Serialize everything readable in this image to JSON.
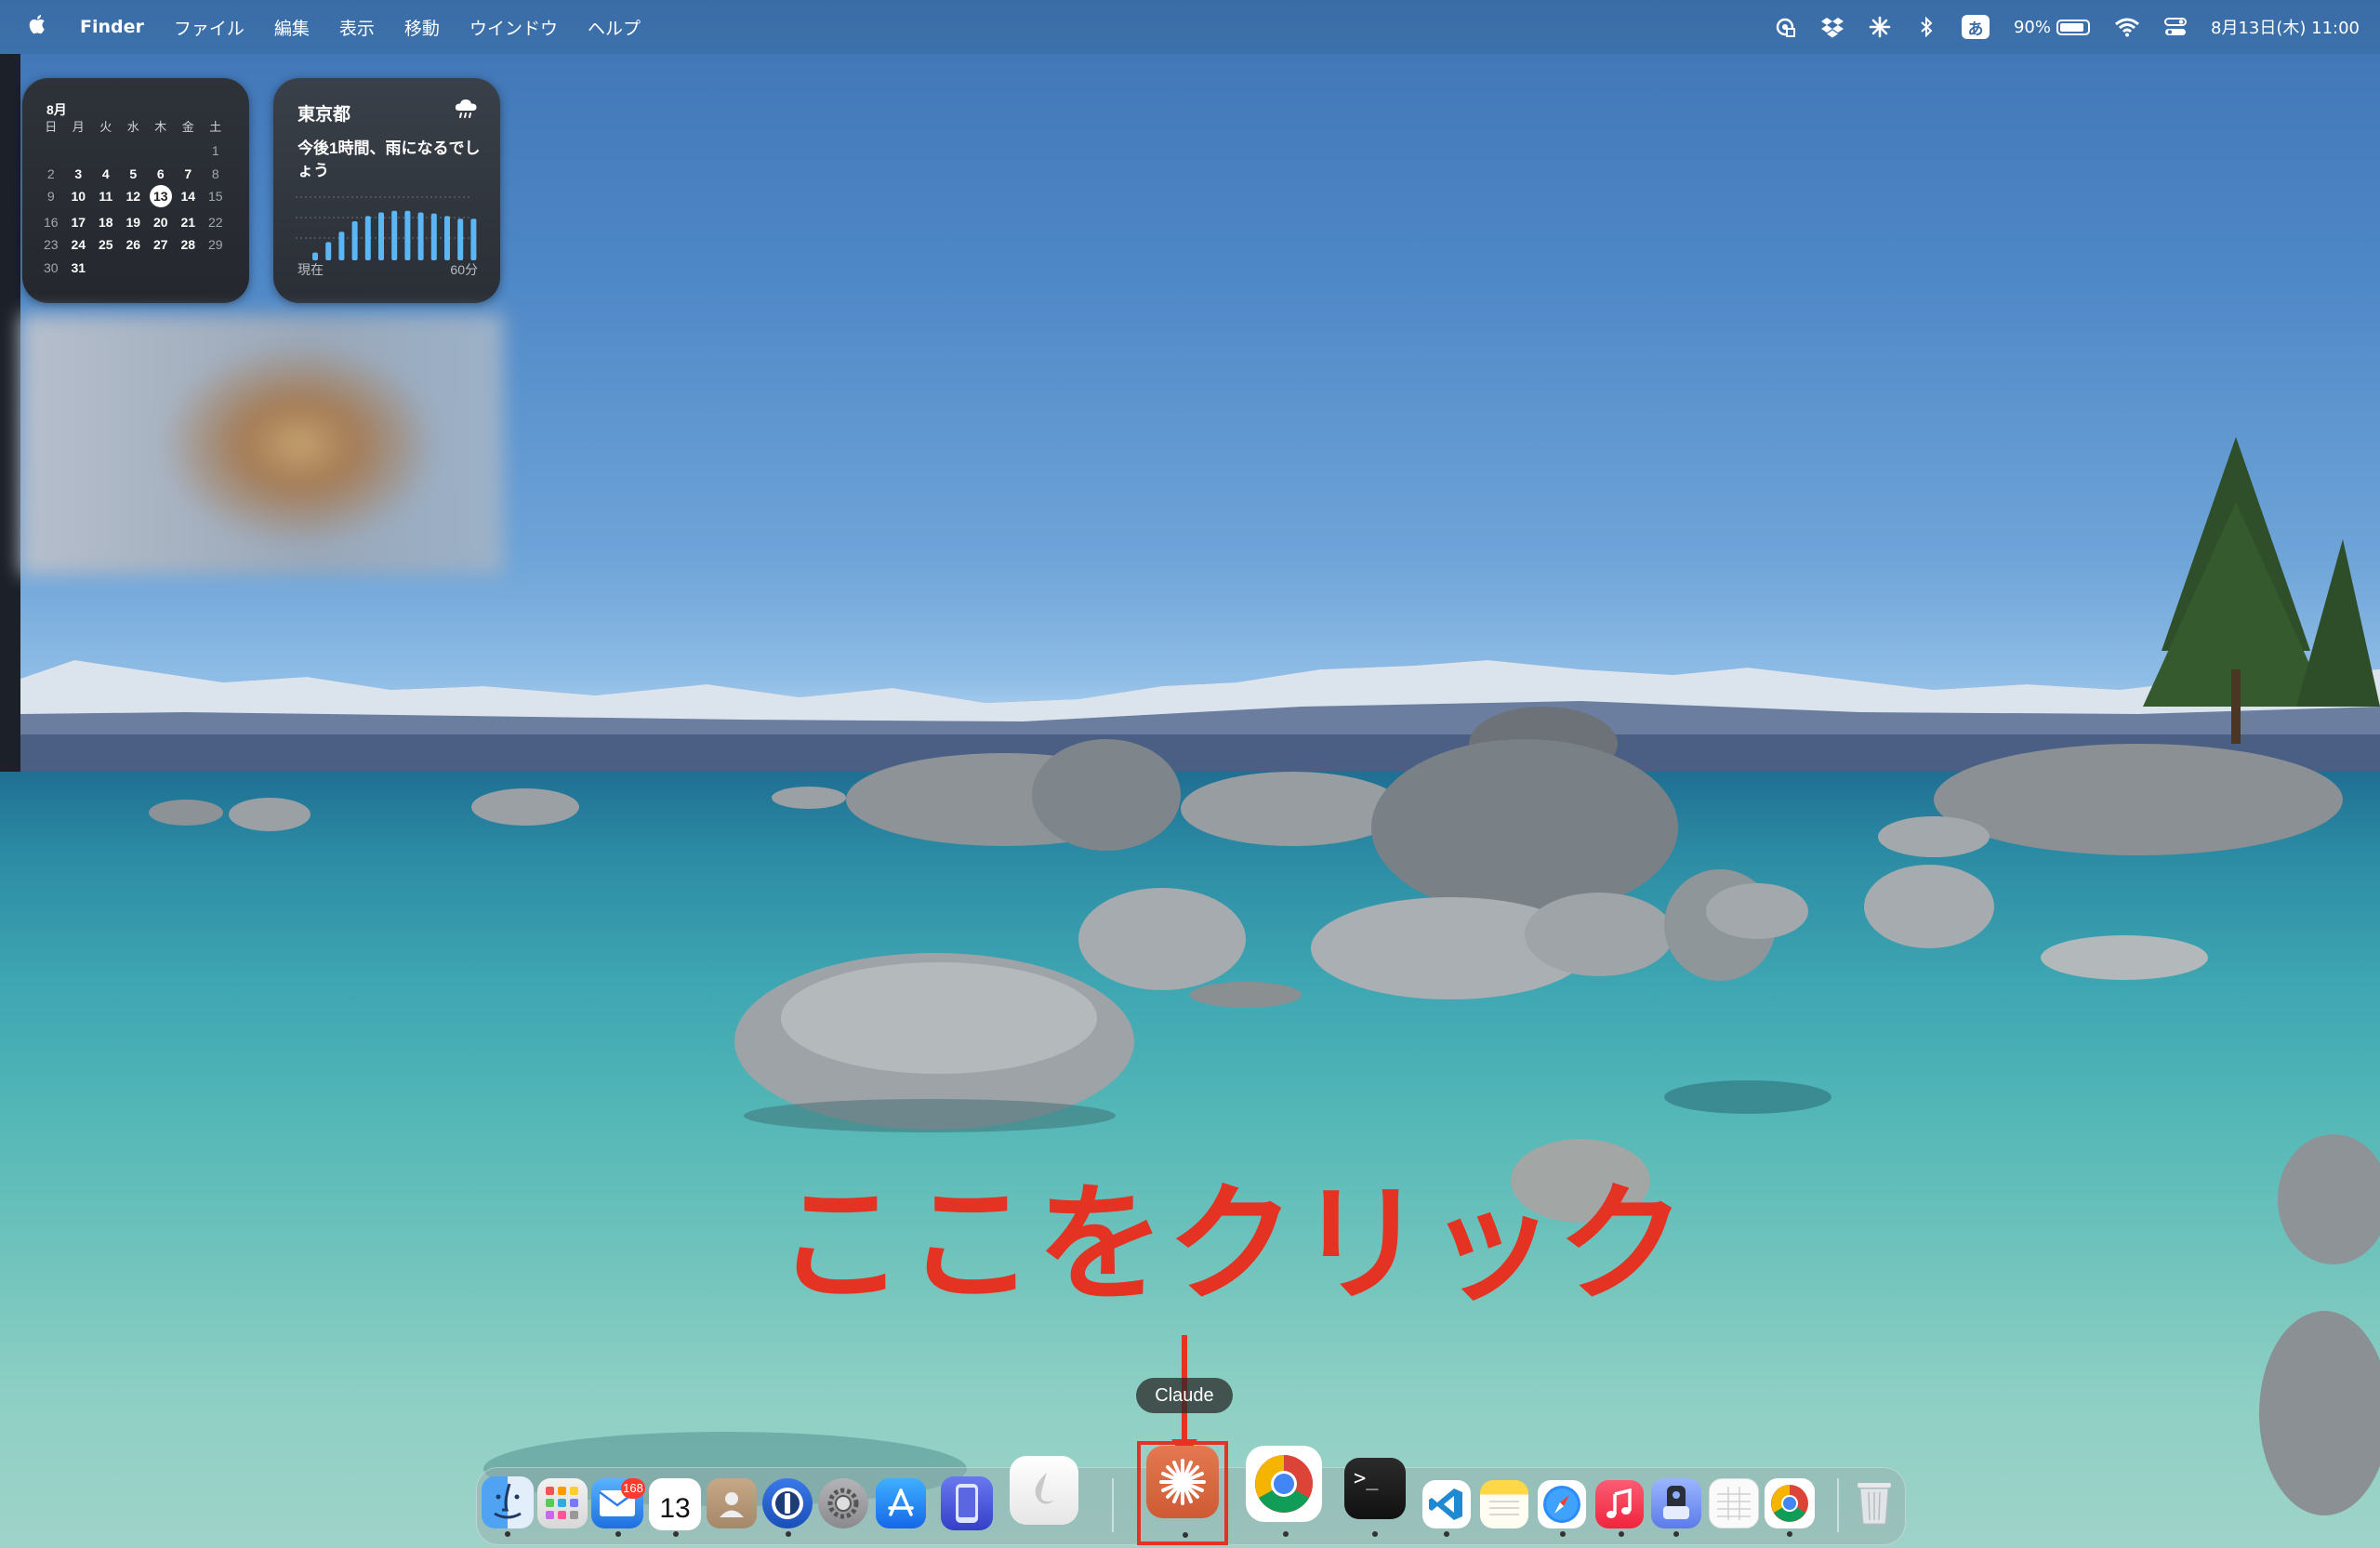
{
  "menubar": {
    "app_name": "Finder",
    "menus": [
      "ファイル",
      "編集",
      "表示",
      "移動",
      "ウインドウ",
      "ヘルプ"
    ],
    "ime_label": "あ",
    "battery_percent": "90%",
    "battery_level": 0.9,
    "datetime": "8月13日(木) 11:00"
  },
  "calendar_widget": {
    "month": "8月",
    "weekdays": [
      "日",
      "月",
      "火",
      "水",
      "木",
      "金",
      "土"
    ],
    "weeks": [
      [
        "",
        "",
        "",
        "",
        "",
        "",
        "1"
      ],
      [
        "2",
        "3",
        "4",
        "5",
        "6",
        "7",
        "8"
      ],
      [
        "9",
        "10",
        "11",
        "12",
        "13",
        "14",
        "15"
      ],
      [
        "16",
        "17",
        "18",
        "19",
        "20",
        "21",
        "22"
      ],
      [
        "23",
        "24",
        "25",
        "26",
        "27",
        "28",
        "29"
      ],
      [
        "30",
        "31",
        "",
        "",
        "",
        "",
        ""
      ]
    ],
    "today": "13"
  },
  "weather_widget": {
    "location": "東京都",
    "message": "今後1時間、雨になるでしょう",
    "label_now": "現在",
    "label_end": "60分",
    "precip_levels": [
      0.15,
      0.35,
      0.55,
      0.75,
      0.85,
      0.92,
      0.95,
      0.95,
      0.92,
      0.9,
      0.85,
      0.8,
      0.8
    ]
  },
  "annotation": {
    "text": "ここをクリック",
    "color": "#e53323"
  },
  "dock": {
    "tooltip": "Claude",
    "mail_badge": "168",
    "calendar_day": "13",
    "terminal_prompt": ">_",
    "apps": [
      "finder-icon",
      "launchpad-icon",
      "mail-icon",
      "calendar-icon",
      "contacts-icon",
      "1password-icon",
      "system-settings-icon",
      "app-store-icon",
      "iphone-mirroring-icon",
      "unknown-app-icon",
      "claude-icon",
      "chrome-icon",
      "terminal-icon",
      "vscode-icon",
      "notes-icon",
      "safari-icon",
      "music-icon",
      "finder-helper-icon",
      "textedit-icon",
      "chrome-alt-icon",
      "trash-icon"
    ]
  }
}
